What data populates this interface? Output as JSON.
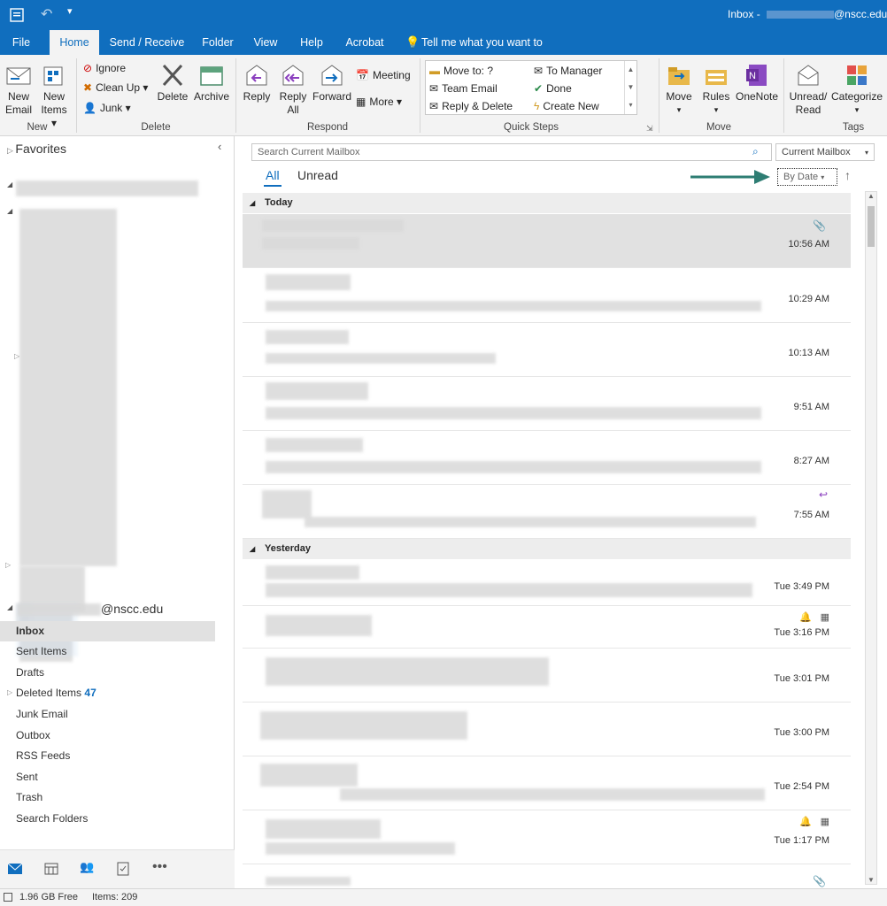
{
  "titlebar": {
    "title": "Inbox -",
    "email_suffix": "@nscc.edu"
  },
  "tabs": [
    "File",
    "Home",
    "Send / Receive",
    "Folder",
    "View",
    "Help",
    "Acrobat"
  ],
  "tell_me": "Tell me what you want to do",
  "ribbon": {
    "new_email": [
      "New",
      "Email"
    ],
    "new_items": [
      "New",
      "Items ▾"
    ],
    "group_new": "New",
    "ignore": "Ignore",
    "cleanup": "Clean Up ▾",
    "junk": "Junk ▾",
    "delete": "Delete",
    "archive": "Archive",
    "group_delete": "Delete",
    "reply": "Reply",
    "reply_all": [
      "Reply",
      "All"
    ],
    "forward": "Forward",
    "meeting": "Meeting",
    "more": "More ▾",
    "group_respond": "Respond",
    "qs": [
      "Move to: ?",
      "Team Email",
      "Reply & Delete",
      "To Manager",
      "Done",
      "Create New"
    ],
    "group_qs": "Quick Steps",
    "move": "Move",
    "rules": "Rules",
    "onenote": "OneNote",
    "group_move": "Move",
    "unread": [
      "Unread/",
      "Read"
    ],
    "categorize": "Categorize",
    "group_tags": "Tags"
  },
  "left": {
    "favorites": "Favorites",
    "account_suffix": "@nscc.edu",
    "folders": [
      "Inbox",
      "Sent Items",
      "Drafts",
      "Deleted Items",
      "Junk Email",
      "Outbox",
      "RSS Feeds",
      "Sent",
      "Trash",
      "Search Folders"
    ],
    "deleted_count": "47"
  },
  "mail": {
    "search_placeholder": "Search Current Mailbox",
    "scope": "Current Mailbox",
    "filter_all": "All",
    "filter_unread": "Unread",
    "sort": "By Date",
    "sort_dir": "↑",
    "groups": {
      "today": "Today",
      "yesterday": "Yesterday"
    },
    "today_times": [
      "10:56 AM",
      "10:29 AM",
      "10:13 AM",
      "9:51 AM",
      "8:27 AM",
      "7:55 AM"
    ],
    "yesterday_times": [
      "Tue 3:49 PM",
      "Tue 3:16 PM",
      "Tue 3:01 PM",
      "Tue 3:00 PM",
      "Tue 2:54 PM",
      "Tue 1:17 PM"
    ]
  },
  "status": {
    "free": "1.96 GB Free",
    "items": "Items: 209"
  },
  "colors": {
    "accent": "#106ebe",
    "arrow": "#2e7d73",
    "selected": "#e1e1e1"
  }
}
